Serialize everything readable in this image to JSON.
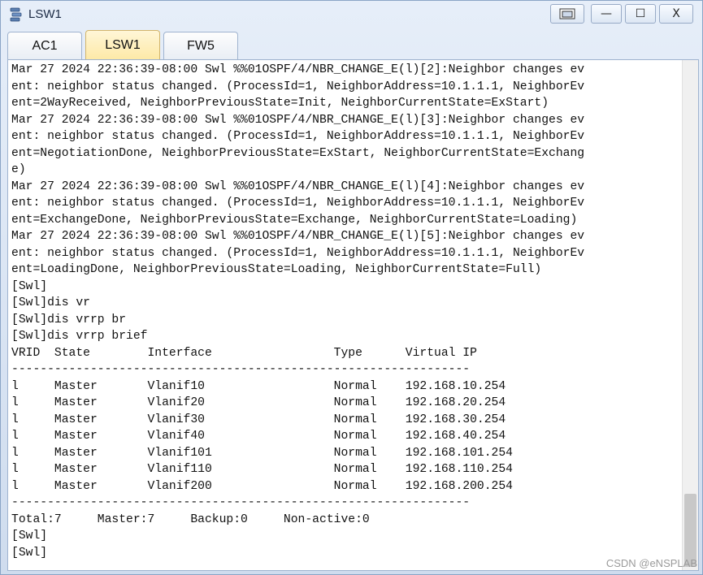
{
  "window": {
    "title": "LSW1",
    "buttons": {
      "restore": "▭",
      "minimize": "—",
      "maximize": "☐",
      "close": "X"
    }
  },
  "tabs": [
    {
      "label": "AC1",
      "active": false
    },
    {
      "label": "LSW1",
      "active": true
    },
    {
      "label": "FW5",
      "active": false
    }
  ],
  "console": {
    "lines": [
      "Mar 27 2024 22:36:39-08:00 Swl %%01OSPF/4/NBR_CHANGE_E(l)[2]:Neighbor changes ev",
      "ent: neighbor status changed. (ProcessId=1, NeighborAddress=10.1.1.1, NeighborEv",
      "ent=2WayReceived, NeighborPreviousState=Init, NeighborCurrentState=ExStart)",
      "Mar 27 2024 22:36:39-08:00 Swl %%01OSPF/4/NBR_CHANGE_E(l)[3]:Neighbor changes ev",
      "ent: neighbor status changed. (ProcessId=1, NeighborAddress=10.1.1.1, NeighborEv",
      "ent=NegotiationDone, NeighborPreviousState=ExStart, NeighborCurrentState=Exchang",
      "e)",
      "Mar 27 2024 22:36:39-08:00 Swl %%01OSPF/4/NBR_CHANGE_E(l)[4]:Neighbor changes ev",
      "ent: neighbor status changed. (ProcessId=1, NeighborAddress=10.1.1.1, NeighborEv",
      "ent=ExchangeDone, NeighborPreviousState=Exchange, NeighborCurrentState=Loading)",
      "Mar 27 2024 22:36:39-08:00 Swl %%01OSPF/4/NBR_CHANGE_E(l)[5]:Neighbor changes ev",
      "ent: neighbor status changed. (ProcessId=1, NeighborAddress=10.1.1.1, NeighborEv",
      "ent=LoadingDone, NeighborPreviousState=Loading, NeighborCurrentState=Full)",
      "[Swl]",
      "[Swl]dis vr",
      "[Swl]dis vrrp br",
      "[Swl]dis vrrp brief",
      "VRID  State        Interface                 Type      Virtual IP",
      "----------------------------------------------------------------",
      "l     Master       Vlanif10                  Normal    192.168.10.254",
      "l     Master       Vlanif20                  Normal    192.168.20.254",
      "l     Master       Vlanif30                  Normal    192.168.30.254",
      "l     Master       Vlanif40                  Normal    192.168.40.254",
      "l     Master       Vlanif101                 Normal    192.168.101.254",
      "l     Master       Vlanif110                 Normal    192.168.110.254",
      "l     Master       Vlanif200                 Normal    192.168.200.254",
      "----------------------------------------------------------------",
      "Total:7     Master:7     Backup:0     Non-active:0",
      "[Swl]",
      "[Swl]"
    ]
  },
  "watermark": "CSDN @eNSPLAB"
}
